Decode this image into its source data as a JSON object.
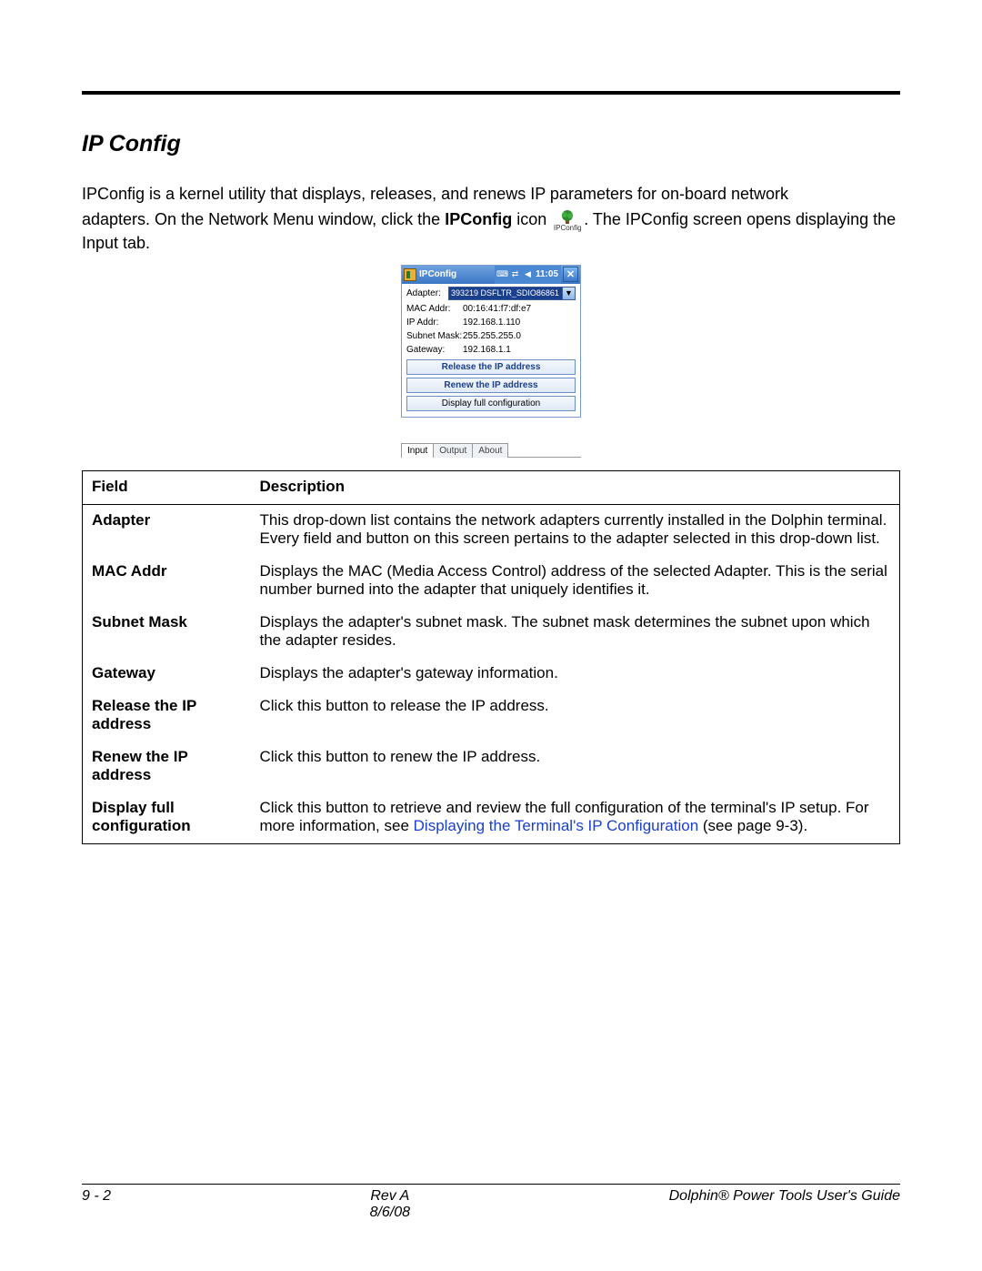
{
  "heading": "IP Config",
  "para1": "IPConfig is a kernel utility that displays, releases, and renews IP parameters for on-board network",
  "para2a": "adapters. On the Network Menu window, click the ",
  "para2b_bold": "IPConfig",
  "para2c": " icon ",
  "icon_caption": "IPConfig",
  "para2d": ". The IPConfig screen opens displaying the Input tab.",
  "window": {
    "title": "IPConfig",
    "time": "11:05",
    "adapter_label": "Adapter:",
    "adapter_value": "393219 DSFLTR_SDIO86861",
    "rows": [
      {
        "label": "MAC Addr:",
        "value": "00:16:41:f7:df:e7"
      },
      {
        "label": "IP Addr:",
        "value": "192.168.1.110"
      },
      {
        "label": "Subnet Mask:",
        "value": "255.255.255.0"
      },
      {
        "label": "Gateway:",
        "value": "192.168.1.1"
      }
    ],
    "btn_release": "Release the IP address",
    "btn_renew": "Renew the IP address",
    "btn_display": "Display full configuration",
    "tabs": [
      "Input",
      "Output",
      "About"
    ]
  },
  "table": {
    "header_field": "Field",
    "header_desc": "Description",
    "rows": [
      {
        "field": "Adapter",
        "desc": "This drop-down list contains the network adapters currently installed in the Dolphin terminal. Every field and button on this screen pertains to the adapter selected in this drop-down list."
      },
      {
        "field": "MAC Addr",
        "desc": "Displays the MAC (Media Access Control) address of the selected Adapter. This is the serial number burned into the adapter that uniquely identifies it."
      },
      {
        "field": "Subnet Mask",
        "desc": "Displays the adapter's subnet mask. The subnet mask determines the subnet upon which the adapter resides."
      },
      {
        "field": "Gateway",
        "desc": "Displays the adapter's gateway information."
      },
      {
        "field": "Release the IP address",
        "desc": "Click this button to release the IP address."
      },
      {
        "field": "Renew the IP address",
        "desc": "Click this button to renew the IP address."
      },
      {
        "field": "Display full configuration",
        "desc_pre": "Click this button to retrieve and review the full configuration of the terminal's IP setup. For more information, see ",
        "desc_link": "Displaying the Terminal's IP Configuration",
        "desc_post": " (see page 9-3)."
      }
    ]
  },
  "footer": {
    "page": "9 - 2",
    "rev": "Rev A",
    "date": "8/6/08",
    "guide": "Dolphin® Power Tools User's Guide"
  }
}
